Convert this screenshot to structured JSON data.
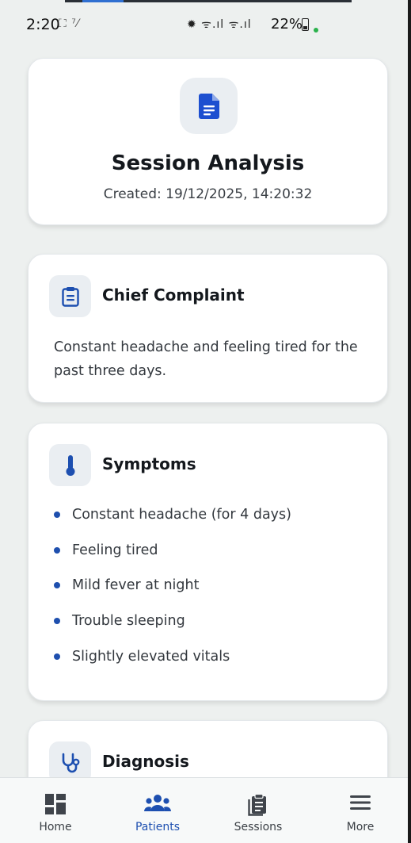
{
  "status_bar": {
    "time": "2:20",
    "left_icons": "⛶ ⁷⁄",
    "right_icons": "✹ ᯤ.ıl ᯤ.ıl",
    "battery": "22%"
  },
  "header": {
    "icon": "document-icon",
    "title": "Session Analysis",
    "created": "Created: 19/12/2025, 14:20:32"
  },
  "chief_complaint": {
    "icon": "clipboard-icon",
    "title": "Chief Complaint",
    "text": "Constant headache and feeling tired for the past three days."
  },
  "symptoms": {
    "icon": "thermometer-icon",
    "title": "Symptoms",
    "items": [
      "Constant headache (for 4 days)",
      "Feeling tired",
      "Mild fever at night",
      "Trouble sleeping",
      "Slightly elevated vitals"
    ]
  },
  "diagnosis": {
    "icon": "stethoscope-icon",
    "title": "Diagnosis"
  },
  "bottom_nav": {
    "items": [
      {
        "label": "Home",
        "icon": "grid-icon"
      },
      {
        "label": "Patients",
        "icon": "people-icon"
      },
      {
        "label": "Sessions",
        "icon": "clipboard-list-icon"
      },
      {
        "label": "More",
        "icon": "menu-icon"
      }
    ],
    "active": "Patients"
  },
  "colors": {
    "accent": "#1d4fb0",
    "background": "#edf0ef",
    "card": "#ffffff"
  }
}
